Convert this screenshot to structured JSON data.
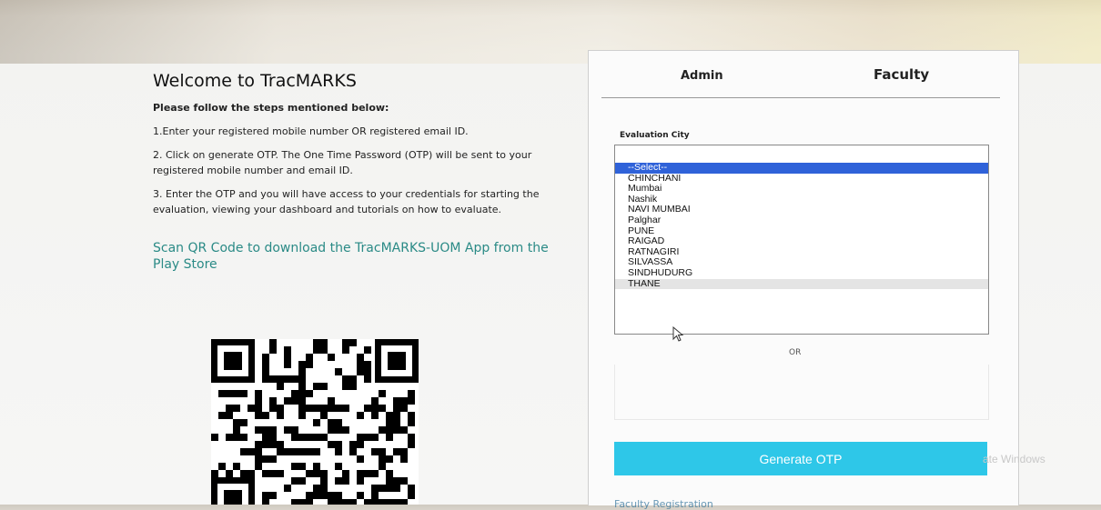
{
  "welcome": {
    "title": "Welcome to TracMARKS",
    "intro": "Please follow the steps mentioned below:",
    "steps": [
      "1.Enter your registered mobile number OR registered email ID.",
      "2. Click on generate OTP. The One Time Password (OTP) will be sent to your registered mobile number and email ID.",
      "3. Enter the OTP and you will have access to your credentials for starting the evaluation, viewing your dashboard and tutorials on how to evaluate."
    ],
    "qr_text": "Scan QR Code to download the TracMARKS-UOM App from the Play Store"
  },
  "tabs": {
    "admin": "Admin",
    "faculty": "Faculty"
  },
  "form": {
    "city_label": "Evaluation City",
    "city_selected": "",
    "city_options": [
      "--Select--",
      "CHINCHANI",
      "Mumbai",
      "Nashik",
      "NAVI MUMBAI",
      "Palghar",
      "PUNE",
      "RAIGAD",
      "RATNAGIRI",
      "SILVASSA",
      "SINDHUDURG",
      "THANE"
    ],
    "highlighted_option": "--Select--",
    "hovered_option": "THANE",
    "or_label": "OR",
    "otp_button": "Generate OTP",
    "registration_link": "Faculty Registration"
  },
  "os_watermark": "ate Windows",
  "colors": {
    "accent_button": "#2ec7e8",
    "selected_option": "#2f62d9",
    "qr_text": "#2a8a86"
  }
}
